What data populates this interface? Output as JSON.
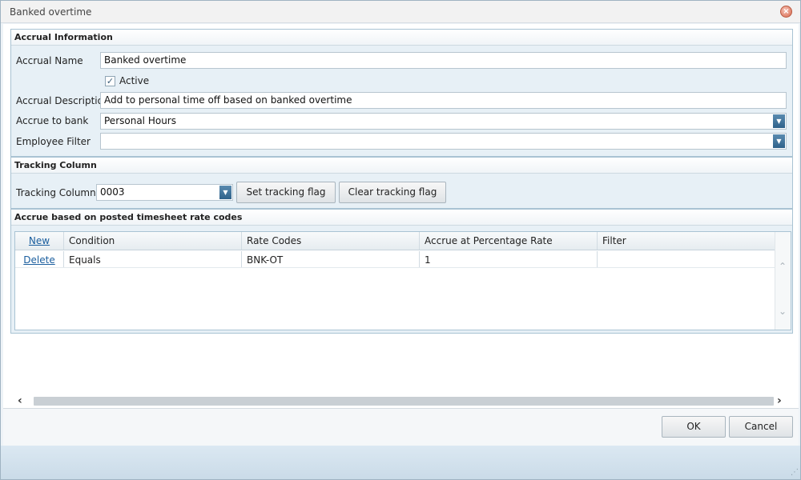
{
  "window": {
    "title": "Banked overtime",
    "close_glyph": "×"
  },
  "accrual_info": {
    "title": "Accrual Information",
    "name_label": "Accrual Name",
    "name_value": "Banked overtime",
    "active_label": "Active",
    "active_checked": true,
    "description_label": "Accrual Description",
    "description_value": "Add to personal time off based on banked overtime",
    "bank_label": "Accrue to bank",
    "bank_value": "Personal Hours",
    "filter_label": "Employee Filter",
    "filter_value": ""
  },
  "tracking": {
    "title": "Tracking Column",
    "column_label": "Tracking Column",
    "column_value": "0003",
    "set_button": "Set tracking flag",
    "clear_button": "Clear tracking flag"
  },
  "rate_codes": {
    "title": "Accrue based on posted timesheet rate codes",
    "new_link": "New",
    "columns": [
      "Condition",
      "Rate Codes",
      "Accrue at Percentage Rate",
      "Filter"
    ],
    "rows": [
      {
        "action": "Delete",
        "condition": "Equals",
        "rate_codes": "BNK-OT",
        "percentage": "1",
        "filter": ""
      }
    ]
  },
  "footer": {
    "ok_label": "OK",
    "cancel_label": "Cancel"
  },
  "icons": {
    "checkmark": "✓",
    "dropdown_arrow": "▼",
    "scroll_up": "⌃",
    "scroll_down": "⌄",
    "scroll_left": "‹",
    "scroll_right": "›",
    "grip": "⋰"
  },
  "colors": {
    "accent": "#2f628a",
    "link": "#1a5e9e",
    "panel": "#e7f0f6"
  }
}
